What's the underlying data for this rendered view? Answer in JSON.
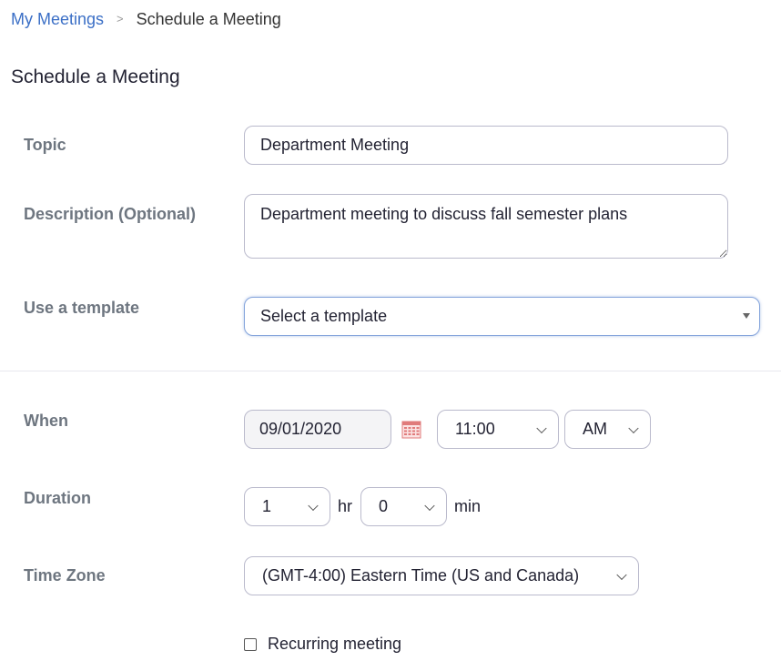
{
  "breadcrumb": {
    "parent": "My Meetings",
    "separator": ">",
    "current": "Schedule a Meeting"
  },
  "page_title": "Schedule a Meeting",
  "form": {
    "topic": {
      "label": "Topic",
      "value": "Department Meeting"
    },
    "description": {
      "label": "Description (Optional)",
      "value": "Department meeting to discuss fall semester plans"
    },
    "template": {
      "label": "Use a template",
      "value": "Select a template"
    },
    "when": {
      "label": "When",
      "date": "09/01/2020",
      "time": "11:00",
      "ampm": "AM"
    },
    "duration": {
      "label": "Duration",
      "hours": "1",
      "hours_unit": "hr",
      "minutes": "0",
      "minutes_unit": "min"
    },
    "timezone": {
      "label": "Time Zone",
      "value": "(GMT-4:00) Eastern Time (US and Canada)"
    },
    "recurring": {
      "label": "Recurring meeting",
      "checked": false
    }
  },
  "colors": {
    "link": "#3b6fc6",
    "label": "#6e7680",
    "border": "#babacc",
    "focus_border": "#86a5dc"
  },
  "icons": {
    "calendar": "calendar-icon",
    "dropdown": "chevron-down-icon",
    "select_caret": "caret-down-icon"
  }
}
